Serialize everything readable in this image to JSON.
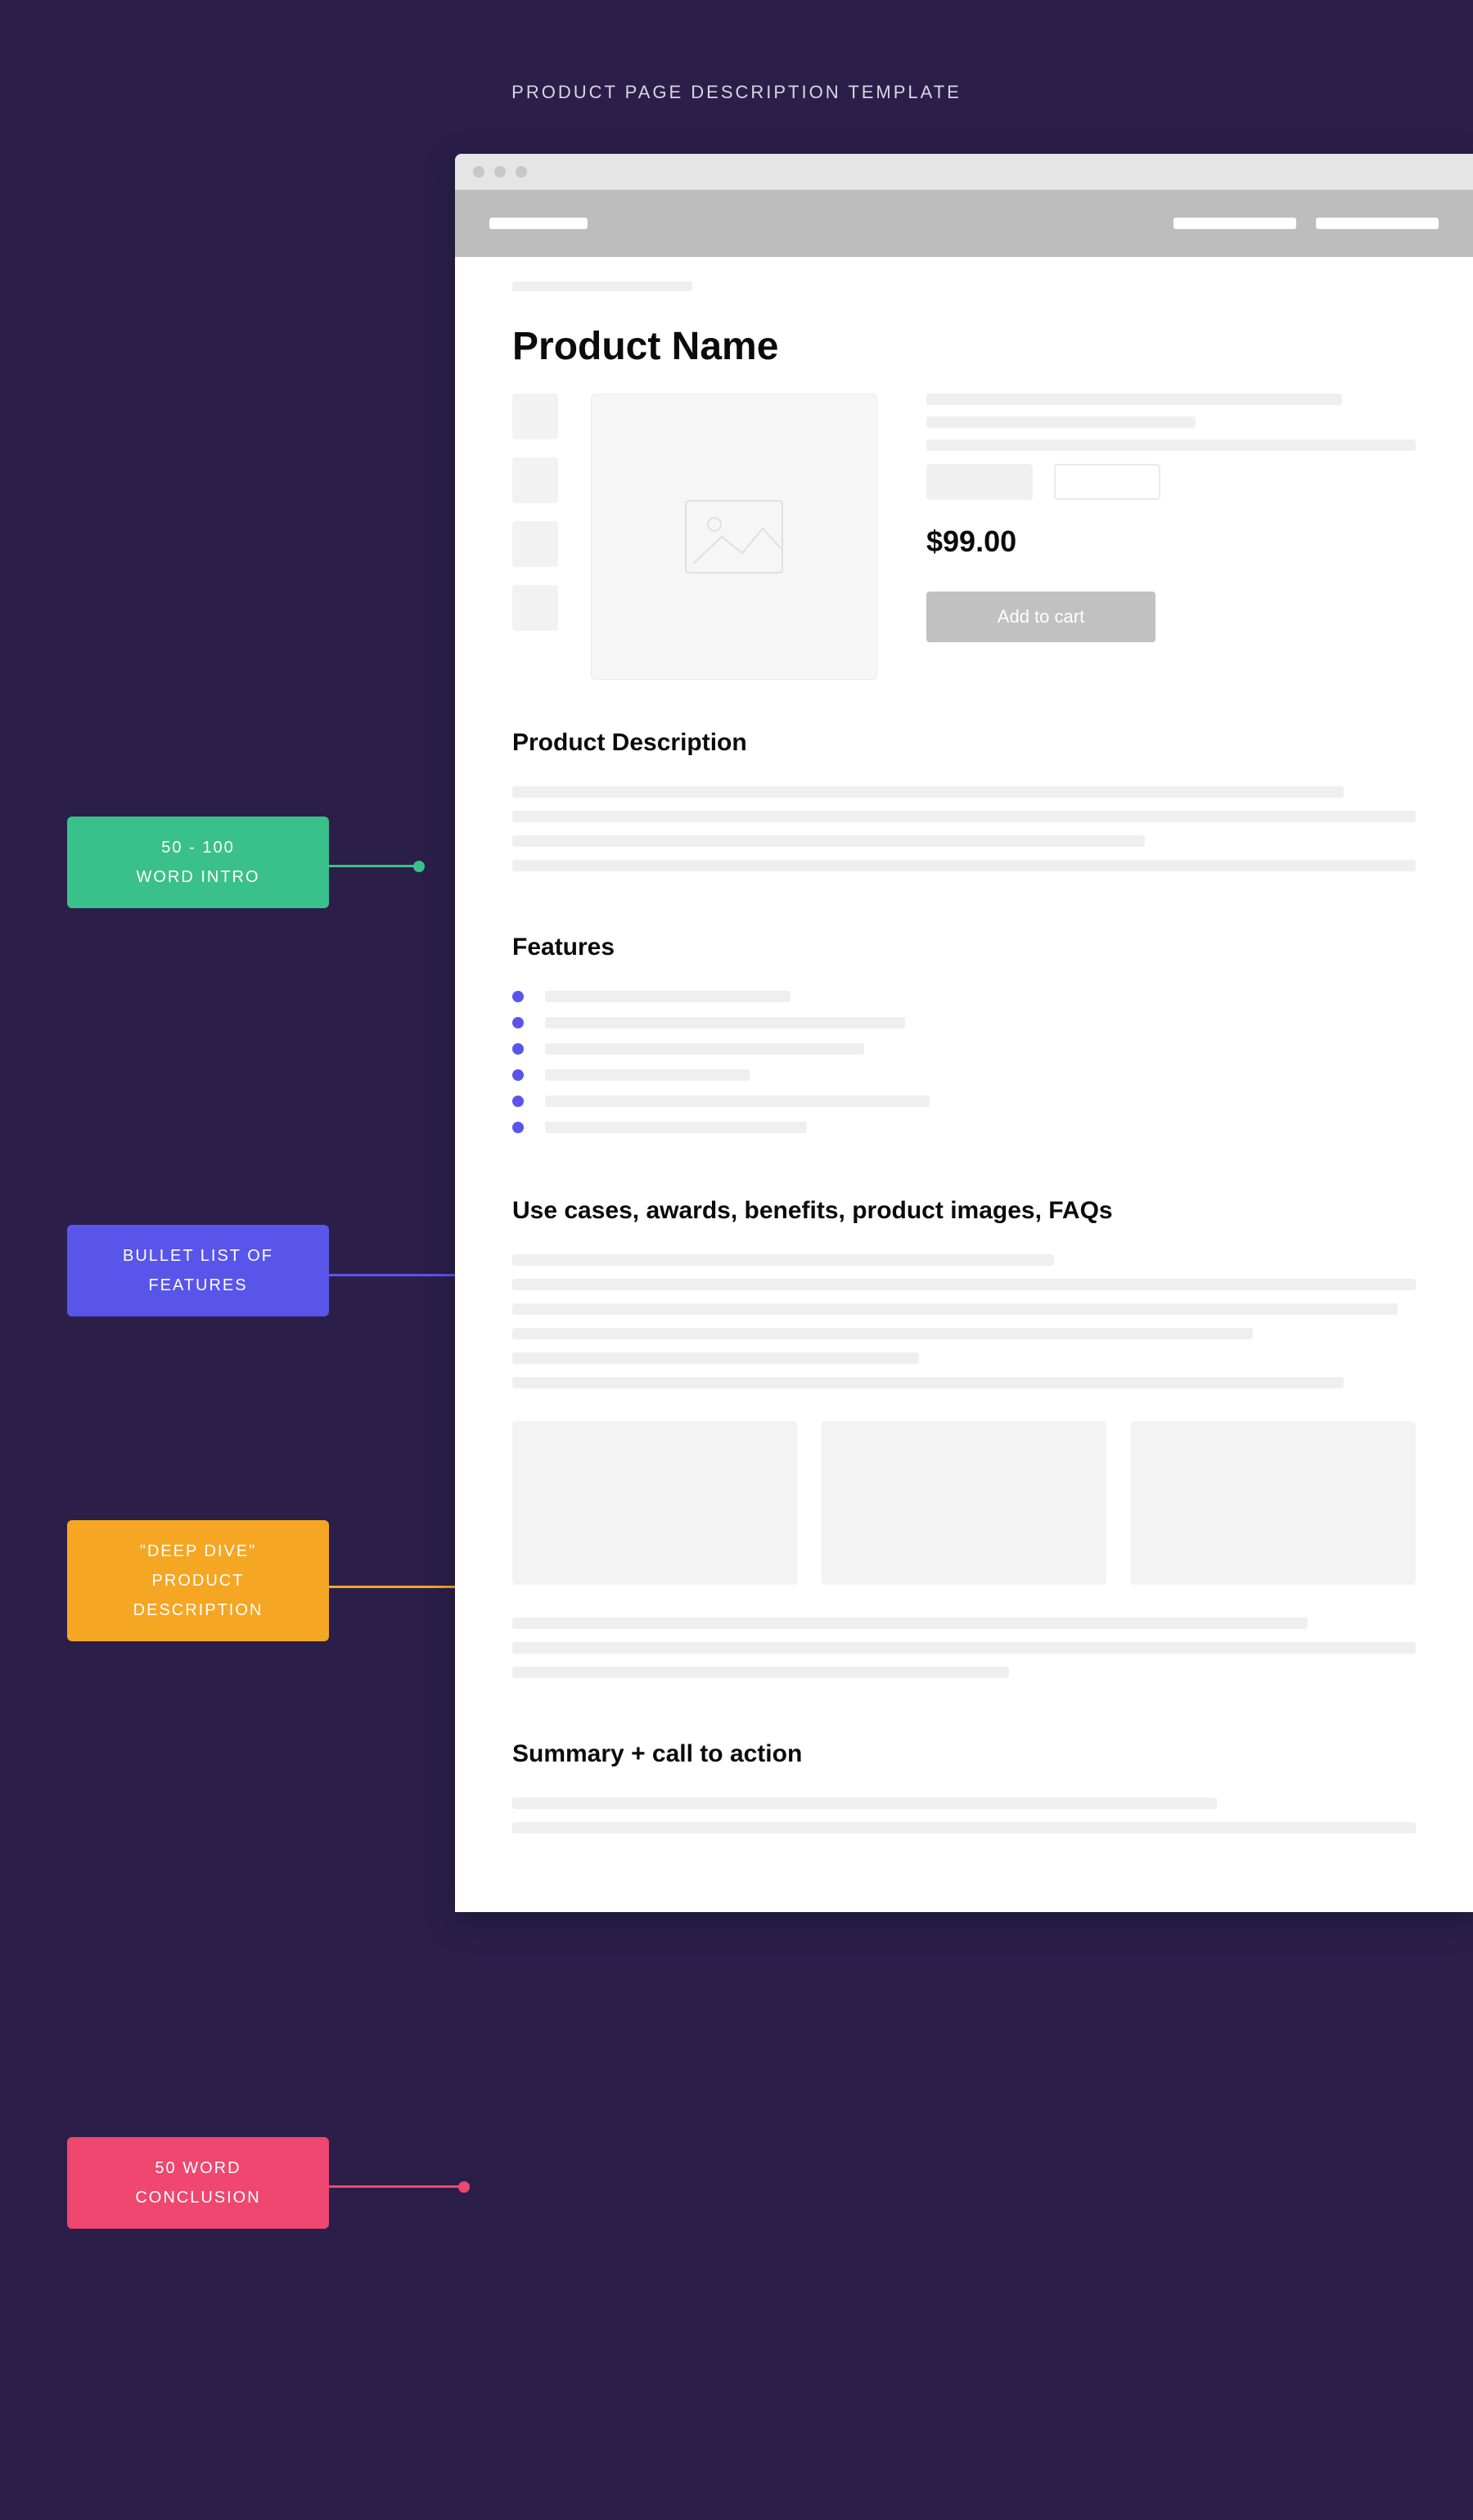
{
  "title": "PRODUCT PAGE DESCRIPTION TEMPLATE",
  "tags": {
    "intro": "50 - 100\nWORD INTRO",
    "features": "BULLET LIST OF\nFEATURES",
    "deepdive": "\"DEEP DIVE\"\nPRODUCT\nDESCRIPTION",
    "conclusion": "50 WORD\nCONCLUSION"
  },
  "product": {
    "name": "Product Name",
    "price": "$99.00",
    "add_to_cart": "Add to cart"
  },
  "sections": {
    "description_title": "Product Description",
    "features_title": "Features",
    "deepdive_title": "Use cases, awards, benefits, product images, FAQs",
    "summary_title": "Summary + call to action"
  },
  "colors": {
    "green": "#3ac08a",
    "blue": "#5a55ea",
    "orange": "#f5a623",
    "red": "#ef476f"
  }
}
